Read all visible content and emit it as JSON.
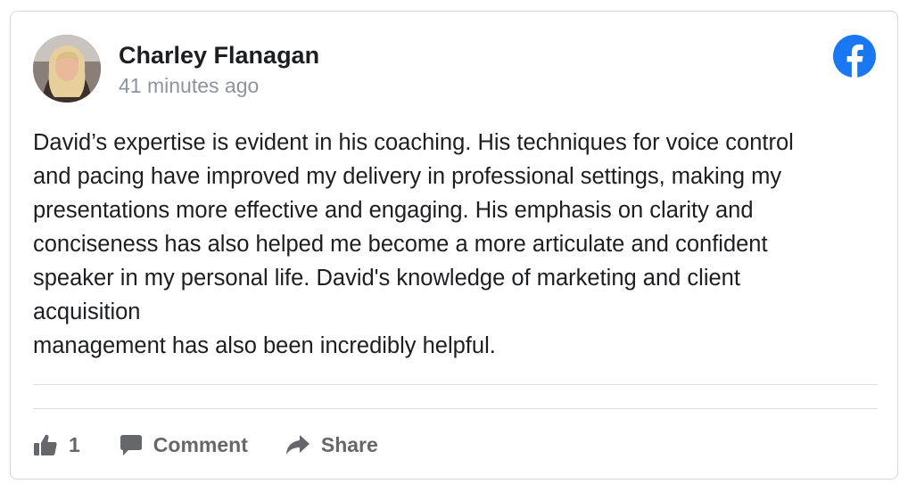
{
  "post": {
    "author_name": "Charley Flanagan",
    "timestamp": "41 minutes ago",
    "source_icon": "facebook-logo-icon",
    "body": "David’s expertise is evident in his coaching. His techniques for voice control\nand pacing have improved my delivery in professional settings, making my\npresentations more effective and engaging. His emphasis on clarity and\nconciseness has also helped me become a more articulate and confident\nspeaker in my personal life. David's knowledge of marketing and client\nacquisition\nmanagement has also been incredibly helpful."
  },
  "actions": {
    "like_count": "1",
    "like_icon": "thumbs-up-icon",
    "comment_label": "Comment",
    "comment_icon": "comment-bubble-icon",
    "share_label": "Share",
    "share_icon": "share-arrow-icon"
  },
  "colors": {
    "facebook_blue": "#1877f2",
    "text_primary": "#1c1e21",
    "text_secondary": "#8d949e",
    "action_gray": "#65676b",
    "border": "#d3d6db"
  }
}
